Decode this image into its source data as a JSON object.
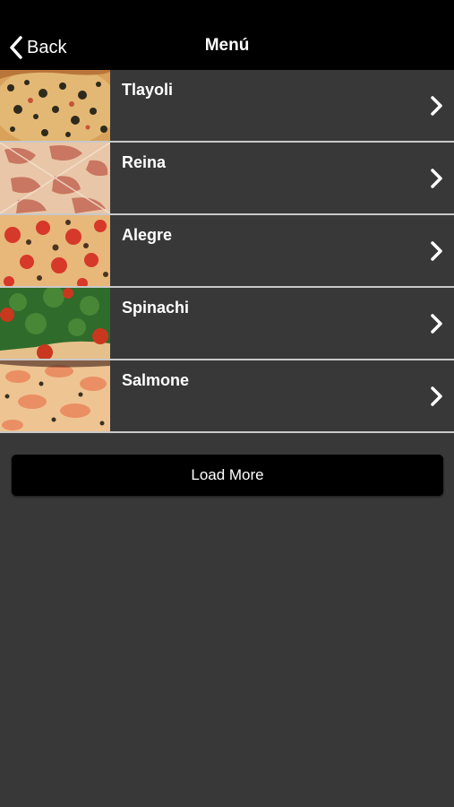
{
  "colors": {
    "navbar_bg": "#000000",
    "list_bg": "#383838",
    "divider": "#c9c9c9",
    "text": "#ffffff",
    "button_bg": "#000000"
  },
  "header": {
    "back_label": "Back",
    "back_icon": "chevron-left-icon",
    "title": "Menú"
  },
  "menu": {
    "items": [
      {
        "label": "Tlayoli",
        "image": "pizza-tlayoli-photo",
        "icon": "chevron-right-icon"
      },
      {
        "label": "Reina",
        "image": "pizza-reina-photo",
        "icon": "chevron-right-icon"
      },
      {
        "label": "Alegre",
        "image": "pizza-alegre-photo",
        "icon": "chevron-right-icon"
      },
      {
        "label": "Spinachi",
        "image": "pizza-spinachi-photo",
        "icon": "chevron-right-icon"
      },
      {
        "label": "Salmone",
        "image": "pizza-salmone-photo",
        "icon": "chevron-right-icon"
      }
    ]
  },
  "load_more": {
    "label": "Load More"
  }
}
